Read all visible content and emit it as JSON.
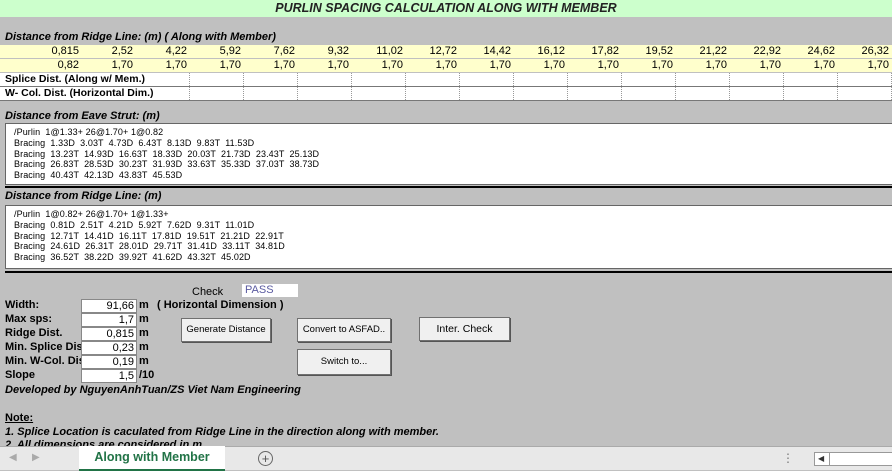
{
  "title": "PURLIN SPACING CALCULATION ALONG WITH MEMBER",
  "ridge_section_label": "Distance from Ridge Line: (m) ( Along with Member)",
  "ridge_distances": [
    "0,815",
    "2,52",
    "4,22",
    "5,92",
    "7,62",
    "9,32",
    "11,02",
    "12,72",
    "14,42",
    "16,12",
    "17,82",
    "19,52",
    "21,22",
    "22,92",
    "24,62",
    "26,32"
  ],
  "spacings": [
    "0,82",
    "1,70",
    "1,70",
    "1,70",
    "1,70",
    "1,70",
    "1,70",
    "1,70",
    "1,70",
    "1,70",
    "1,70",
    "1,70",
    "1,70",
    "1,70",
    "1,70",
    "1,70"
  ],
  "splice_label": "Splice Dist. (Along w/ Mem.)",
  "wcol_label": "W- Col. Dist. (Horizontal Dim.)",
  "eave_section_label": "Distance from Eave Strut: (m)",
  "eave_lines": [
    "/Purlin  1@1.33+ 26@1.70+ 1@0.82",
    "Bracing  1.33D  3.03T  4.73D  6.43T  8.13D  9.83T  11.53D",
    "Bracing  13.23T  14.93D  16.63T  18.33D  20.03T  21.73D  23.43T  25.13D",
    "Bracing  26.83T  28.53D  30.23T  31.93D  33.63T  35.33D  37.03T  38.73D",
    "Bracing  40.43T  42.13D  43.83T  45.53D"
  ],
  "ridge2_section_label": "Distance from Ridge Line: (m)",
  "ridge2_lines": [
    "/Purlin  1@0.82+ 26@1.70+ 1@1.33+",
    "Bracing  0.81D  2.51T  4.21D  5.92T  7.62D  9.31T  11.01D",
    "Bracing  12.71T  14.41D  16.11T  17.81D  19.51T  21.21D  22.91T",
    "Bracing  24.61D  26.31T  28.01D  29.71T  31.41D  33.11T  34.81D",
    "Bracing  36.52T  38.22D  39.92T  41.62D  43.32T  45.02D"
  ],
  "check_label": "Check",
  "check_value": "PASS",
  "params": [
    {
      "label": "Width:",
      "value": "91,66",
      "unit": "m"
    },
    {
      "label": "Max sps:",
      "value": "1,7",
      "unit": "m"
    },
    {
      "label": "Ridge Dist.",
      "value": "0,815",
      "unit": "m"
    },
    {
      "label": "Min. Splice Dis",
      "value": "0,23",
      "unit": "m"
    },
    {
      "label": "Min. W-Col. Dis",
      "value": "0,19",
      "unit": "m"
    },
    {
      "label": "Slope",
      "value": "1,5",
      "unit": "/10"
    }
  ],
  "horizontal_note": "( Horizontal Dimension )",
  "buttons": {
    "generate": "Generate Distance",
    "convert": "Convert to ASFAD..",
    "inter_check": "Inter. Check",
    "switch": "Switch to..."
  },
  "developer": "Developed by NguyenAnhTuan/ZS Viet Nam Engineering",
  "note_title": "Note:",
  "note_1": "1. Splice Location  is caculated from Ridge Line in the direction along with member.",
  "note_2": "2. All dimensions are considered in m",
  "sheet_tab": "Along with Member",
  "add_sheet_icon": "plus-circle-icon"
}
